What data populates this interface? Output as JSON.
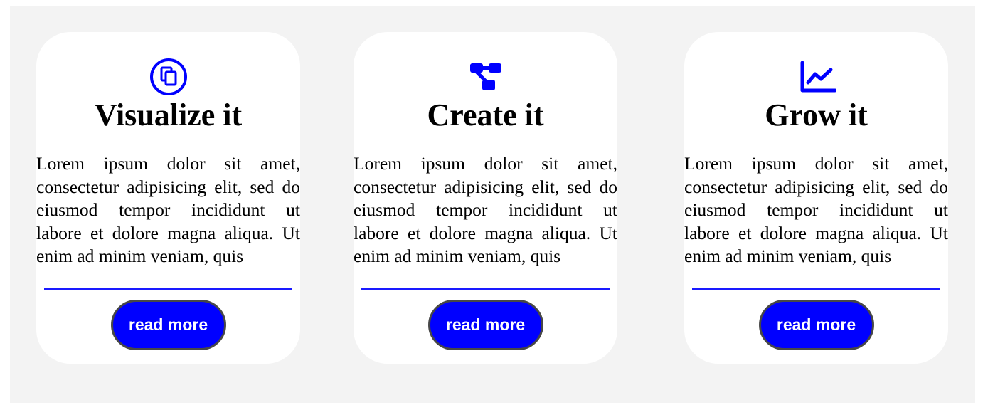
{
  "colors": {
    "accent": "#0000ff",
    "panel_background": "#f3f3f3",
    "card_background": "#ffffff",
    "button_border": "#474747"
  },
  "cards": [
    {
      "icon": "copy-icon",
      "title": "Visualize it",
      "description": "Lorem ipsum dolor sit amet, consectetur adipisicing elit, sed do eiusmod tempor incididunt ut labore et dolore magna aliqua. Ut enim ad minim veniam, quis",
      "button_label": "read more"
    },
    {
      "icon": "sitemap-icon",
      "title": "Create it",
      "description": "Lorem ipsum dolor sit amet, consectetur adipisicing elit, sed do eiusmod tempor incididunt ut labore et dolore magna aliqua. Ut enim ad minim veniam, quis",
      "button_label": "read more"
    },
    {
      "icon": "line-chart-icon",
      "title": "Grow it",
      "description": "Lorem ipsum dolor sit amet, consectetur adipisicing elit, sed do eiusmod tempor incididunt ut labore et dolore magna aliqua. Ut enim ad minim veniam, quis",
      "button_label": "read more"
    }
  ]
}
